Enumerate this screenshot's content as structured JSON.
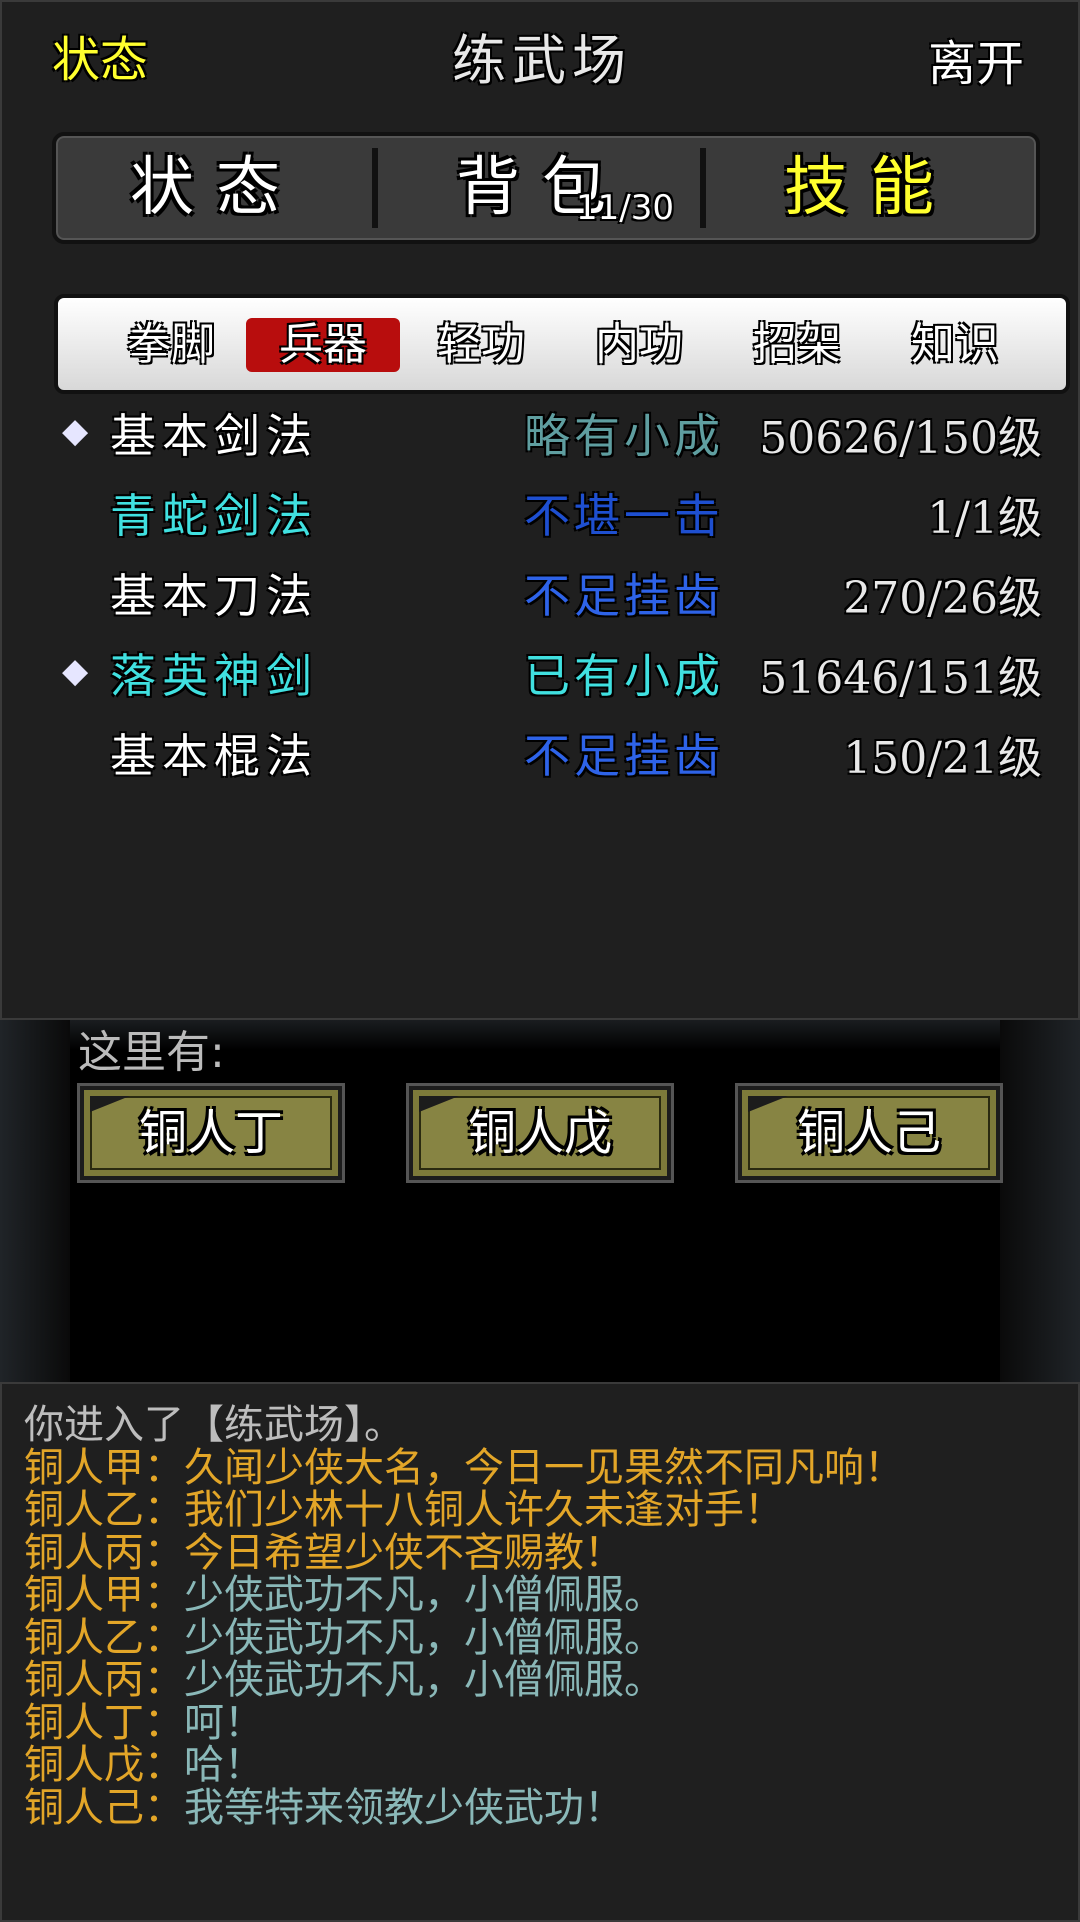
{
  "header": {
    "left_label": "状态",
    "title": "练武场",
    "right_label": "离开"
  },
  "main_tabs": [
    {
      "label": "状态"
    },
    {
      "label": "背包",
      "count": "11/30"
    },
    {
      "label": "技能",
      "active": true
    }
  ],
  "sub_tabs": [
    {
      "label": "拳脚"
    },
    {
      "label": "兵器",
      "active": true
    },
    {
      "label": "轻功"
    },
    {
      "label": "内功"
    },
    {
      "label": "招架"
    },
    {
      "label": "知识"
    }
  ],
  "skills": [
    {
      "marked": true,
      "name": "基本剑法",
      "name_color": "#ffffff",
      "grade": "略有小成",
      "grade_color": "#5f9ea0",
      "level": "50626/150级"
    },
    {
      "marked": false,
      "name": "青蛇剑法",
      "name_color": "#40e0e0",
      "grade": "不堪一击",
      "grade_color": "#1e4fd0",
      "level": "1/1级"
    },
    {
      "marked": false,
      "name": "基本刀法",
      "name_color": "#ffffff",
      "grade": "不足挂齿",
      "grade_color": "#2e63e8",
      "level": "270/26级"
    },
    {
      "marked": true,
      "name": "落英神剑",
      "name_color": "#40e0e0",
      "grade": "已有小成",
      "grade_color": "#40e0e0",
      "level": "51646/151级"
    },
    {
      "marked": false,
      "name": "基本棍法",
      "name_color": "#ffffff",
      "grade": "不足挂齿",
      "grade_color": "#2e63e8",
      "level": "150/21级"
    }
  ],
  "scene": {
    "here_label": "这里有:",
    "npcs": [
      "铜人丁",
      "铜人戊",
      "铜人己"
    ]
  },
  "log": [
    {
      "speaker": "",
      "text": "你进入了【练武场】。",
      "style": "sys"
    },
    {
      "speaker": "铜人甲：",
      "text": "久闻少侠大名，今日一见果然不同凡响！",
      "style": "gold"
    },
    {
      "speaker": "铜人乙：",
      "text": "我们少林十八铜人许久未逢对手！",
      "style": "gold"
    },
    {
      "speaker": "铜人丙：",
      "text": "今日希望少侠不吝赐教！",
      "style": "gold"
    },
    {
      "speaker": "铜人甲：",
      "text": "少侠武功不凡，小僧佩服。",
      "style": "teal"
    },
    {
      "speaker": "铜人乙：",
      "text": "少侠武功不凡，小僧佩服。",
      "style": "teal"
    },
    {
      "speaker": "铜人丙：",
      "text": "少侠武功不凡，小僧佩服。",
      "style": "teal"
    },
    {
      "speaker": "铜人丁：",
      "text": "呵！",
      "style": "teal"
    },
    {
      "speaker": "铜人戊：",
      "text": "哈！",
      "style": "teal"
    },
    {
      "speaker": "铜人己：",
      "text": "我等特来领教少侠武功！",
      "style": "teal"
    }
  ]
}
